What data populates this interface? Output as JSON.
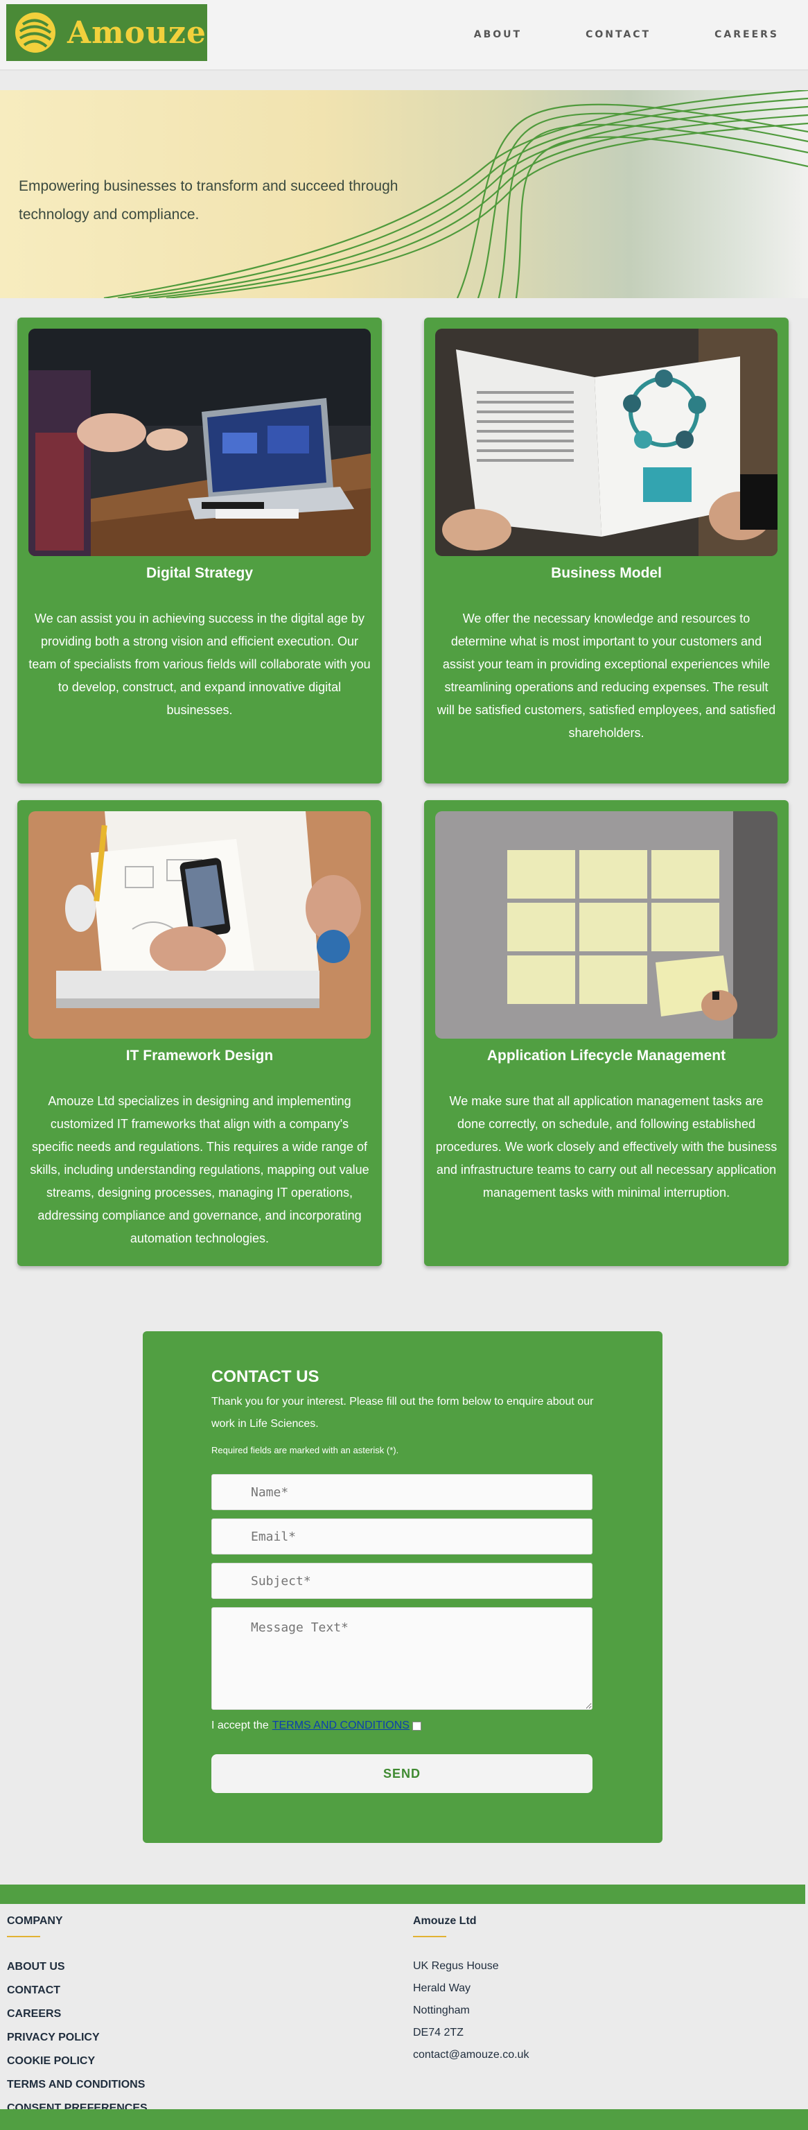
{
  "header": {
    "logo_text": "Amouze",
    "nav": [
      "ABOUT",
      "CONTACT",
      "CAREERS"
    ]
  },
  "hero": {
    "tagline": "Empowering businesses to transform and succeed through technology and compliance."
  },
  "services": [
    {
      "title": "Digital Strategy",
      "description": "We can assist you in achieving success in the digital age by providing both a strong vision and efficient execution. Our team of specialists from various fields will collaborate with you to develop, construct, and expand innovative digital businesses."
    },
    {
      "title": "Business Model",
      "description": "We offer the necessary knowledge and resources to determine what is most important to your customers and assist your team in providing exceptional experiences while streamlining operations and reducing expenses. The result will be satisfied customers, satisfied employees, and satisfied shareholders."
    },
    {
      "title": "IT Framework Design",
      "description": "Amouze Ltd specializes in designing and implementing customized IT frameworks that align with a company's specific needs and regulations. This requires a wide range of skills, including understanding regulations, mapping out value streams, designing processes, managing IT operations, addressing compliance and governance, and incorporating automation technologies."
    },
    {
      "title": "Application Lifecycle Management",
      "description": "We make sure that all application management tasks are done correctly, on schedule, and following established procedures. We work closely and effectively with the business and infrastructure teams to carry out all necessary application management tasks with minimal interruption."
    }
  ],
  "contact": {
    "title": "CONTACT US",
    "intro": "Thank you for your interest. Please fill out the form below to enquire about our work in Life Sciences.",
    "required_note": "Required fields are marked with an asterisk (*).",
    "name_placeholder": "Name*",
    "email_placeholder": "Email*",
    "subject_placeholder": "Subject*",
    "message_placeholder": "Message Text*",
    "terms_prefix": "I accept the",
    "terms_link": "TERMS AND CONDITIONS",
    "send_label": "SEND"
  },
  "footer": {
    "company_heading": "COMPANY",
    "links": [
      "ABOUT US",
      "CONTACT",
      "CAREERS",
      "PRIVACY POLICY",
      "COOKIE POLICY",
      "TERMS AND CONDITIONS",
      "CONSENT PREFERENCES"
    ],
    "address_heading": "Amouze Ltd",
    "address": [
      "UK Regus House",
      "Herald Way",
      "Nottingham",
      "DE74 2TZ",
      "contact@amouze.co.uk"
    ]
  },
  "colors": {
    "brand_green": "#519f42",
    "logo_green": "#4a8a37",
    "logo_yellow": "#f2d03c",
    "accent_gold": "#e2b233"
  }
}
